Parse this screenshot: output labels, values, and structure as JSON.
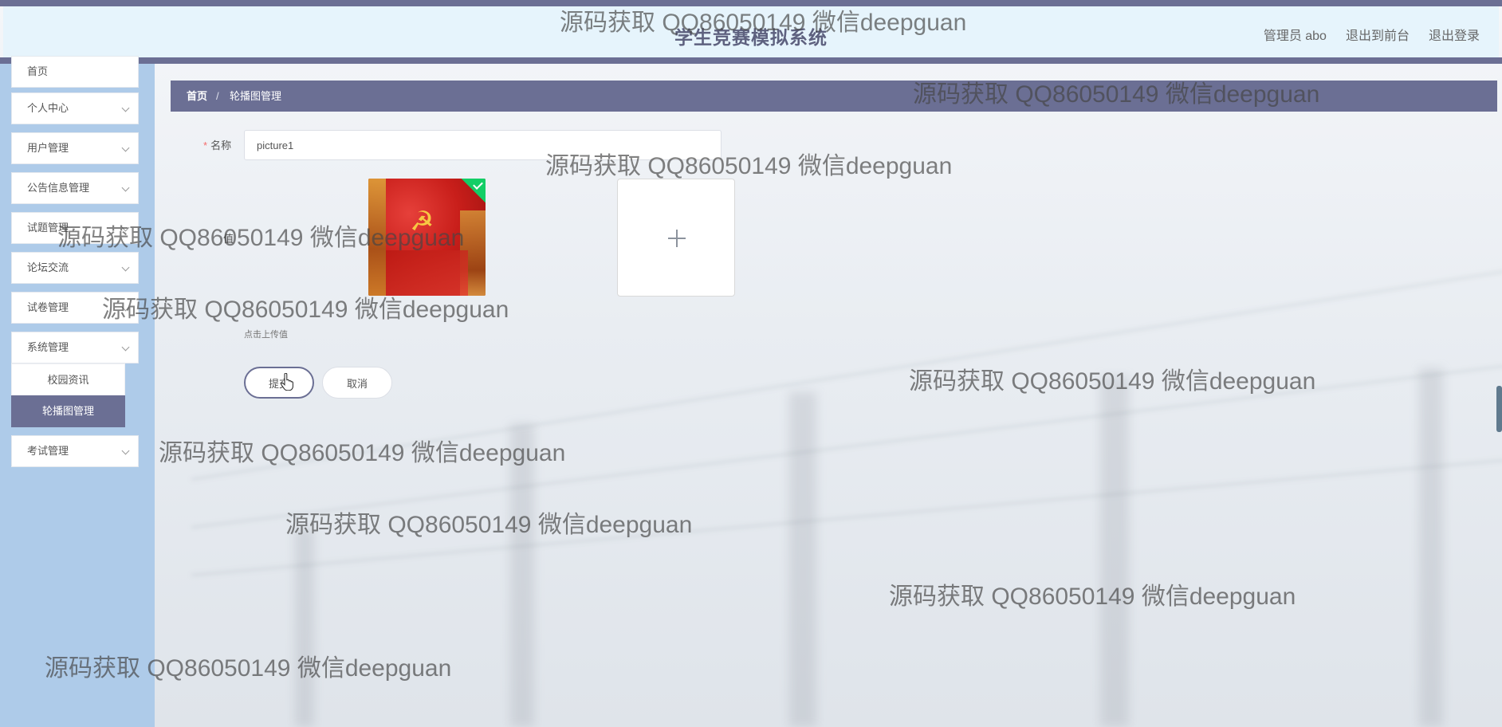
{
  "header": {
    "title": "学生竞赛模拟系统",
    "nav": [
      "管理员 abo",
      "退出到前台",
      "退出登录"
    ]
  },
  "sidebar": {
    "items": [
      {
        "label": "首页"
      },
      {
        "label": "个人中心"
      },
      {
        "label": "用户管理"
      },
      {
        "label": "公告信息管理"
      },
      {
        "label": "试题管理"
      },
      {
        "label": "论坛交流"
      },
      {
        "label": "试卷管理"
      },
      {
        "label": "系统管理"
      },
      {
        "label": "考试管理"
      }
    ],
    "submenu": [
      "校园资讯",
      "轮播图管理"
    ]
  },
  "breadcrumb": {
    "home": "首页",
    "separator": "/",
    "current": "轮播图管理"
  },
  "form": {
    "name_label": "名称",
    "name_value": "picture1",
    "image_label": "值",
    "upload_tip": "点击上传值",
    "submit_label": "提交",
    "cancel_label": "取消"
  },
  "watermark": "源码获取 QQ86050149 微信deepguan",
  "colors": {
    "accent": "#6b6f94",
    "header_bg": "#e6f4fc",
    "sidebar_bg": "#aecbe9",
    "success": "#13ce66",
    "required": "#f56c6c"
  },
  "icons": {
    "menu_arrow": "chevron-down-icon",
    "upload": "plus-icon",
    "uploaded": "check-icon",
    "cursor": "hand-cursor-icon"
  }
}
